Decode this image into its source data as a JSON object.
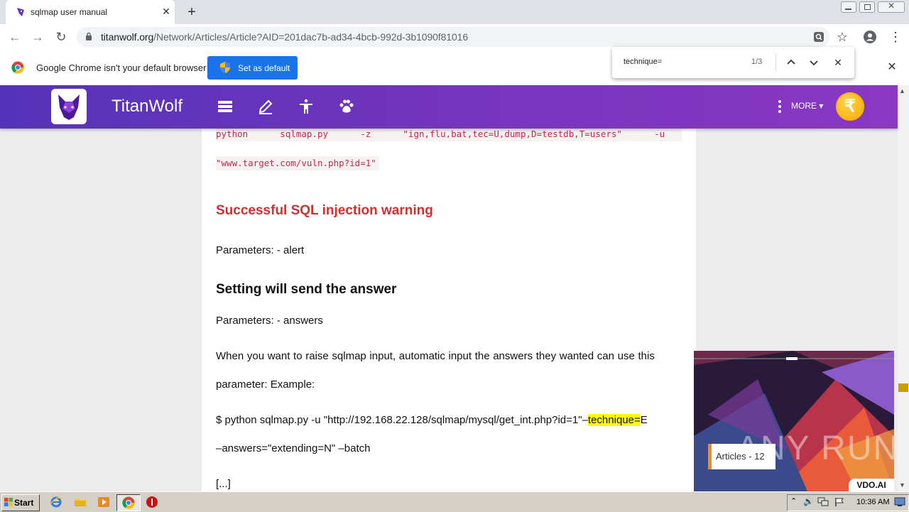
{
  "browser": {
    "tab_title": "sqlmap user manual",
    "url_host": "titanwolf.org",
    "url_path": "/Network/Articles/Article?AID=201dac7b-ad34-4bcb-992d-3b1090f81016",
    "info_text": "Google Chrome isn't your default browser",
    "default_button": "Set as default",
    "find": {
      "query": "technique=",
      "count": "1/3"
    }
  },
  "site": {
    "brand": "TitanWolf",
    "more_label": "MORE",
    "coin_symbol": "₹",
    "accent": "#6a34bf"
  },
  "article": {
    "code_line1": "python      sqlmap.py      -z      \"ign,flu,bat,tec=U,dump,D=testdb,T=users\"      -u",
    "code_line2": "\"www.target.com/vuln.php?id=1\"",
    "heading_red": "Successful SQL injection warning",
    "param_alert": "Parameters: - alert",
    "heading_answer": "Setting will send the answer",
    "param_answers": "Parameters: - answers",
    "desc_line1": "When you want to raise sqlmap input, automatic input the answers they wanted can use this",
    "desc_line2": "parameter: Example:",
    "cmd_pre": "$ python sqlmap.py -u \"http://192.168.22.128/sqlmap/mysql/get_int.php?id=1\"–",
    "cmd_highlight": "technique=",
    "cmd_post": "E",
    "cmd_line2": "–answers=\"extending=N\" –batch",
    "ellipsis": "[...]"
  },
  "video_ad": {
    "tag": "Articles - 12",
    "vdo_logo": "VDO.AI",
    "watermark": "ANY RUN"
  },
  "taskbar": {
    "start": "Start",
    "clock": "10:36 AM"
  }
}
